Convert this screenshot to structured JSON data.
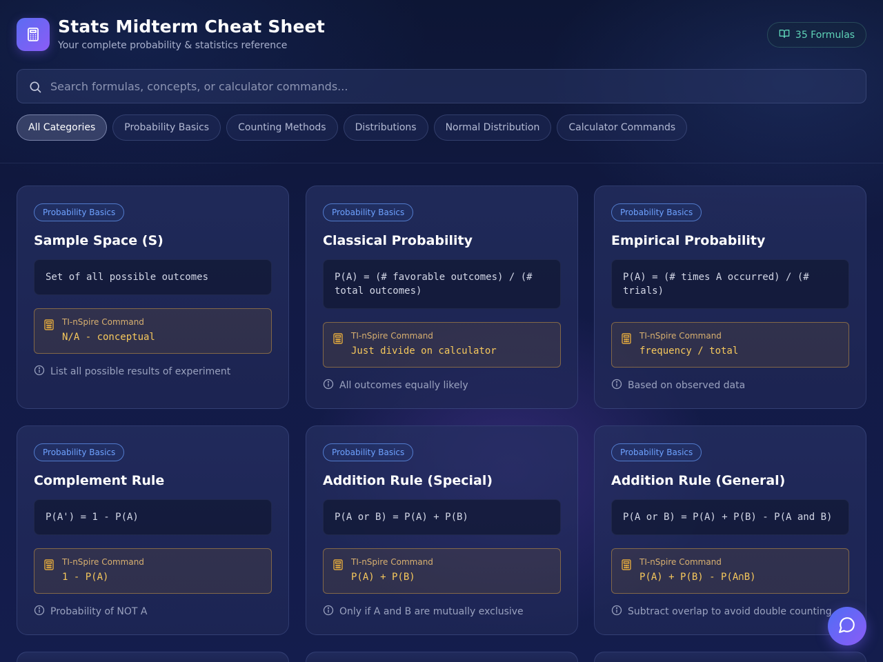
{
  "app": {
    "title": "Stats Midterm Cheat Sheet",
    "subtitle": "Your complete probability & statistics reference",
    "formula_count": "35 Formulas"
  },
  "search": {
    "placeholder": "Search formulas, concepts, or calculator commands...",
    "value": ""
  },
  "categories": [
    {
      "label": "All Categories",
      "active": true
    },
    {
      "label": "Probability Basics",
      "active": false
    },
    {
      "label": "Counting Methods",
      "active": false
    },
    {
      "label": "Distributions",
      "active": false
    },
    {
      "label": "Normal Distribution",
      "active": false
    },
    {
      "label": "Calculator Commands",
      "active": false
    }
  ],
  "command_label": "TI-nSpire Command",
  "cards": [
    {
      "tag": "Probability Basics",
      "title": "Sample Space (S)",
      "formula": "Set of all possible outcomes",
      "command": "N/A - conceptual",
      "note": "List all possible results of experiment"
    },
    {
      "tag": "Probability Basics",
      "title": "Classical Probability",
      "formula": "P(A) = (# favorable outcomes) / (# total outcomes)",
      "command": "Just divide on calculator",
      "note": "All outcomes equally likely"
    },
    {
      "tag": "Probability Basics",
      "title": "Empirical Probability",
      "formula": "P(A) = (# times A occurred) / (# trials)",
      "command": "frequency / total",
      "note": "Based on observed data"
    },
    {
      "tag": "Probability Basics",
      "title": "Complement Rule",
      "formula": "P(A') = 1 - P(A)",
      "command": "1 - P(A)",
      "note": "Probability of NOT A"
    },
    {
      "tag": "Probability Basics",
      "title": "Addition Rule (Special)",
      "formula": "P(A or B) = P(A) + P(B)",
      "command": "P(A) + P(B)",
      "note": "Only if A and B are mutually exclusive"
    },
    {
      "tag": "Probability Basics",
      "title": "Addition Rule (General)",
      "formula": "P(A or B) = P(A) + P(B) - P(A and B)",
      "command": "P(A) + P(B) - P(A∩B)",
      "note": "Subtract overlap to avoid double counting"
    }
  ],
  "colors": {
    "accent_blue": "#6ea2ff",
    "accent_teal": "#5fd4b8",
    "command_gold": "#f6c85c",
    "logo_gradient_start": "#5b6cf2",
    "logo_gradient_end": "#8b5cf6"
  },
  "icons": {
    "logo": "calculator-icon",
    "formula_count": "book-open-icon",
    "search": "search-icon",
    "command": "calculator-icon",
    "note": "info-icon",
    "fab": "chat-bubble-icon"
  }
}
